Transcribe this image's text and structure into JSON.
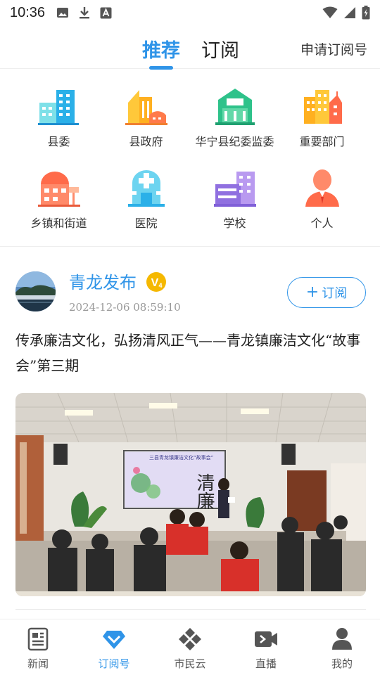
{
  "status_bar": {
    "time": "10:36",
    "left_icons": [
      "image-icon",
      "download-icon",
      "text-icon"
    ],
    "right_icons": [
      "wifi-icon",
      "signal-icon",
      "battery-icon"
    ]
  },
  "top_tabs": {
    "tabs": [
      {
        "label": "推荐",
        "active": true
      },
      {
        "label": "订阅",
        "active": false
      }
    ],
    "apply_link": "申请订阅号"
  },
  "categories": [
    {
      "label": "县委",
      "icon": "county-committee-building-icon"
    },
    {
      "label": "县政府",
      "icon": "county-government-building-icon"
    },
    {
      "label": "华宁县纪委监委",
      "icon": "discipline-commission-building-icon"
    },
    {
      "label": "重要部门",
      "icon": "departments-building-icon"
    },
    {
      "label": "乡镇和街道",
      "icon": "township-building-icon"
    },
    {
      "label": "医院",
      "icon": "hospital-icon"
    },
    {
      "label": "学校",
      "icon": "school-icon"
    },
    {
      "label": "个人",
      "icon": "person-icon"
    }
  ],
  "post": {
    "channel_name": "青龙发布",
    "verified_badge": "V",
    "time": "2024-12-06 08:59:10",
    "follow_label": "订阅",
    "title": "传承廉洁文化，弘扬清风正气——青龙镇廉洁文化“故事会”第三期",
    "image": {
      "screen_characters": "清廉",
      "screen_caption": "三县青龙镇廉洁文化“故事会”"
    }
  },
  "bottom_nav": [
    {
      "label": "新闻",
      "icon": "newspaper-icon",
      "active": false
    },
    {
      "label": "订阅号",
      "icon": "diamond-chevron-icon",
      "active": true
    },
    {
      "label": "市民云",
      "icon": "cloud-grid-icon",
      "active": false
    },
    {
      "label": "直播",
      "icon": "video-camera-icon",
      "active": false
    },
    {
      "label": "我的",
      "icon": "user-icon",
      "active": false
    }
  ],
  "colors": {
    "accent": "#2f94e8",
    "text": "#222222",
    "muted": "#999999"
  }
}
